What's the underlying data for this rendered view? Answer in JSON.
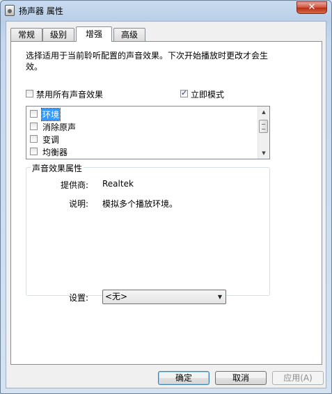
{
  "window": {
    "title": "扬声器 属性",
    "close_label": "✕"
  },
  "tabs": [
    {
      "label": "常规"
    },
    {
      "label": "级别"
    },
    {
      "label": "增强"
    },
    {
      "label": "高级"
    }
  ],
  "active_tab_index": 2,
  "enhancements": {
    "description": "选择适用于当前聆听配置的声音效果。下次开始播放时更改才会生效。",
    "disable_all": {
      "label": "禁用所有声音效果",
      "checked": false
    },
    "immediate_mode": {
      "label": "立即模式",
      "checked": true
    },
    "effects": [
      {
        "label": "环境",
        "checked": false,
        "selected": true
      },
      {
        "label": "消除原声",
        "checked": false,
        "selected": false
      },
      {
        "label": "变调",
        "checked": false,
        "selected": false
      },
      {
        "label": "均衡器",
        "checked": false,
        "selected": false
      }
    ],
    "properties": {
      "group_title": "声音效果属性",
      "provider_label": "提供商:",
      "provider_value": "Realtek",
      "description_label": "说明:",
      "description_value": "模拟多个播放环境。",
      "settings_label": "设置:",
      "settings_value": "<无>"
    }
  },
  "buttons": {
    "ok": "确定",
    "cancel": "取消",
    "apply": "应用(A)"
  },
  "icons": {
    "window_icon": "speaker-properties-icon",
    "scroll_up": "scroll-up-arrow-icon",
    "scroll_down": "scroll-down-arrow-icon",
    "dropdown": "chevron-down-icon"
  }
}
